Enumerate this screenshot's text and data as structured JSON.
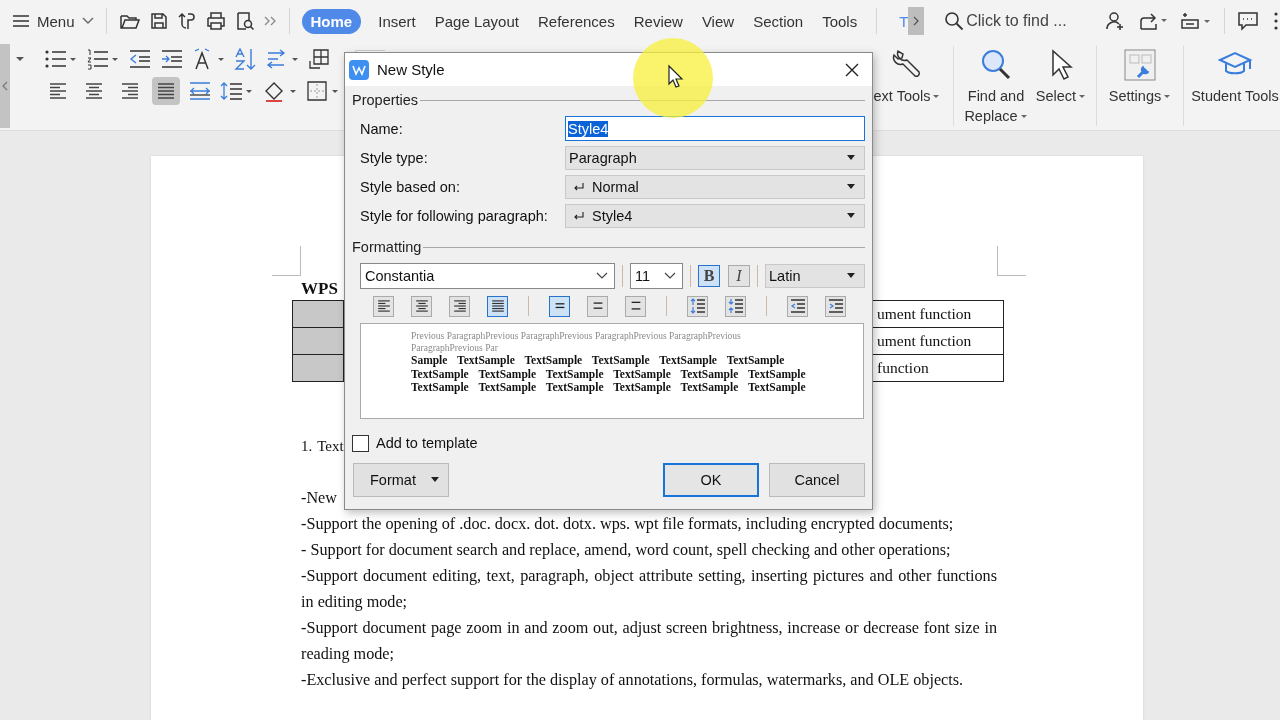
{
  "menu_bar": {
    "menu_label": "Menu",
    "tabs": [
      {
        "label": "Home",
        "selected": true
      },
      {
        "label": "Insert",
        "selected": false
      },
      {
        "label": "Page Layout",
        "selected": false
      },
      {
        "label": "References",
        "selected": false
      },
      {
        "label": "Review",
        "selected": false
      },
      {
        "label": "View",
        "selected": false
      },
      {
        "label": "Section",
        "selected": false
      },
      {
        "label": "Tools",
        "selected": false
      }
    ],
    "partial_tab": "T",
    "search": {
      "placeholder": "Click to find ..."
    }
  },
  "ribbon": {
    "align_buttons": [
      {
        "kind": "left",
        "selected": false
      },
      {
        "kind": "center",
        "selected": false
      },
      {
        "kind": "right",
        "selected": false
      },
      {
        "kind": "justify",
        "selected": true
      }
    ],
    "tools": [
      {
        "kind": "wrench",
        "label": "ext Tools",
        "dropdown": true
      },
      {
        "kind": "search",
        "label": "Find and Replace",
        "dropdown": true
      },
      {
        "kind": "pointer",
        "label": "Select",
        "dropdown": true
      },
      {
        "kind": "settings",
        "label": "Settings",
        "dropdown": true
      },
      {
        "kind": "cap",
        "label": "Student Tools",
        "dropdown": false
      }
    ]
  },
  "document": {
    "heading": "WPS",
    "table_rows": [
      {
        "cell": "ument function"
      },
      {
        "cell": "ument function"
      },
      {
        "cell": "function"
      }
    ],
    "list_item": {
      "number": "1.",
      "text": "Text"
    },
    "paragraphs": [
      "-New",
      "-Support the opening of .doc. docx. dot. dotx. wps. wpt file formats, including encrypted documents;",
      "- Support for document search and replace, amend, word count, spell checking and other operations;",
      "-Support document editing, text, paragraph, object attribute setting, inserting pictures and other functions in editing mode;",
      "-Support document page zoom in and zoom out, adjust screen brightness, increase or decrease font size in reading mode;",
      "-Exclusive and perfect support for the display of annotations, formulas, watermarks, and OLE objects."
    ]
  },
  "dialog": {
    "title": "New Style",
    "properties_label": "Properties",
    "name": {
      "label": "Name:",
      "value": "Style4",
      "value_selected": true
    },
    "selects": [
      {
        "label": "Style type:",
        "value": "Paragraph",
        "return_mark": false
      },
      {
        "label": "Style based on:",
        "value": "Normal",
        "return_mark": true
      },
      {
        "label": "Style for following paragraph:",
        "value": "Style4",
        "return_mark": true
      }
    ],
    "formatting_label": "Formatting",
    "font": "Constantia",
    "size": "11",
    "bold": {
      "label": "B",
      "selected": true
    },
    "italic": {
      "label": "I",
      "selected": false
    },
    "script": "Latin",
    "alignment": [
      {
        "kind": "left",
        "selected": false
      },
      {
        "kind": "center",
        "selected": false
      },
      {
        "kind": "right",
        "selected": false
      },
      {
        "kind": "justify",
        "selected": true
      }
    ],
    "line_spacing": [
      {
        "kind": "single",
        "selected": true
      },
      {
        "kind": "one_half",
        "selected": false
      },
      {
        "kind": "double",
        "selected": false
      }
    ],
    "preview": {
      "previous": "Previous ParagraphPrevious ParagraphPrevious ParagraphPrevious ParagraphPrevious ParagraphPrevious Par",
      "sample_lines": [
        "Sample TextSample TextSample TextSample TextSample TextSample",
        "TextSample TextSample TextSample TextSample TextSample TextSample",
        "TextSample TextSample TextSample TextSample TextSample TextSample"
      ]
    },
    "add_to_template": {
      "label": "Add to template",
      "checked": false
    },
    "buttons": [
      {
        "kind": "menu",
        "label": "Format",
        "default": false
      },
      {
        "kind": "plain",
        "label": "OK",
        "default": true
      },
      {
        "kind": "plain",
        "label": "Cancel",
        "default": false
      }
    ]
  }
}
